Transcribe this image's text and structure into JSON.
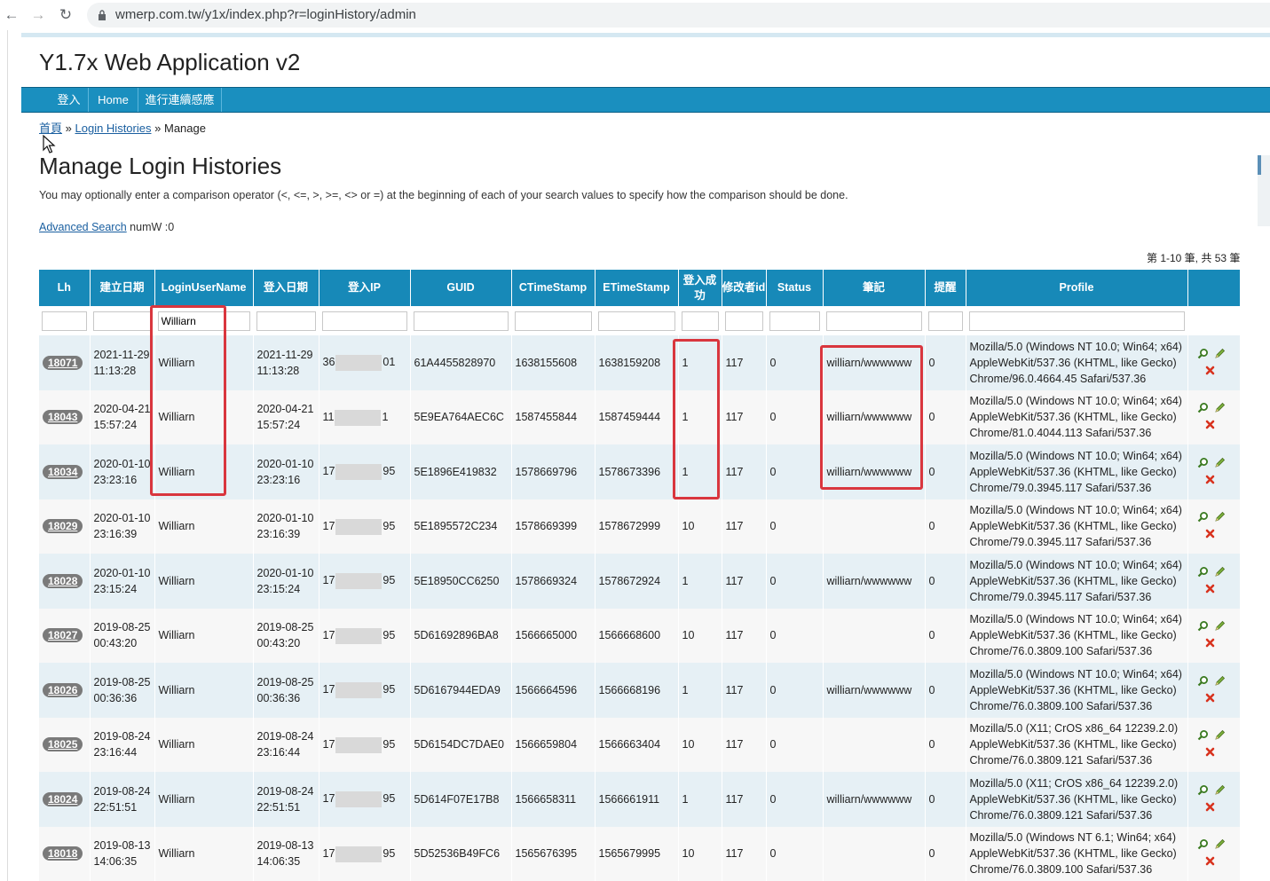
{
  "browser": {
    "url": "wmerp.com.tw/y1x/index.php?r=loginHistory/admin"
  },
  "site": {
    "title": "Y1.7x Web Application v2",
    "menu": [
      "登入",
      "Home",
      "進行連續感應"
    ]
  },
  "breadcrumb": {
    "home": "首頁",
    "sep": "»",
    "list": "Login Histories",
    "current": "Manage"
  },
  "page": {
    "title": "Manage Login Histories",
    "hint": "You may optionally enter a comparison operator (<, <=, >, >=, <> or =) at the beginning of each of your search values to specify how the comparison should be done.",
    "advanced_search": "Advanced Search",
    "numw": "numW :0",
    "summary": "第 1-10 筆, 共 53 筆"
  },
  "table": {
    "headers": [
      "Lh",
      "建立日期",
      "LoginUserName",
      "登入日期",
      "登入IP",
      "GUID",
      "CTimeStamp",
      "ETimeStamp",
      "登入成功",
      "修改者id",
      "Status",
      "筆記",
      "提醒",
      "Profile",
      ""
    ],
    "filter_username": "Williarn",
    "rows": [
      {
        "id": "18071",
        "created": "2021-11-29 11:13:28",
        "user": "Williarn",
        "login": "2021-11-29 11:13:28",
        "ip_a": "36",
        "ip_b": "01",
        "guid": "61A4455828970",
        "ct": "1638155608",
        "et": "1638159208",
        "ok": "1",
        "mod": "117",
        "status": "0",
        "note": "williarn/wwwwww",
        "remind": "0",
        "profile": "Mozilla/5.0 (Windows NT 10.0; Win64; x64) AppleWebKit/537.36 (KHTML, like Gecko) Chrome/96.0.4664.45 Safari/537.36"
      },
      {
        "id": "18043",
        "created": "2020-04-21 15:57:24",
        "user": "Williarn",
        "login": "2020-04-21 15:57:24",
        "ip_a": "11",
        "ip_b": "1",
        "guid": "5E9EA764AEC6C",
        "ct": "1587455844",
        "et": "1587459444",
        "ok": "1",
        "mod": "117",
        "status": "0",
        "note": "williarn/wwwwww",
        "remind": "0",
        "profile": "Mozilla/5.0 (Windows NT 10.0; Win64; x64) AppleWebKit/537.36 (KHTML, like Gecko) Chrome/81.0.4044.113 Safari/537.36"
      },
      {
        "id": "18034",
        "created": "2020-01-10 23:23:16",
        "user": "Williarn",
        "login": "2020-01-10 23:23:16",
        "ip_a": "17",
        "ip_b": "95",
        "guid": "5E1896E419832",
        "ct": "1578669796",
        "et": "1578673396",
        "ok": "1",
        "mod": "117",
        "status": "0",
        "note": "williarn/wwwwww",
        "remind": "0",
        "profile": "Mozilla/5.0 (Windows NT 10.0; Win64; x64) AppleWebKit/537.36 (KHTML, like Gecko) Chrome/79.0.3945.117 Safari/537.36"
      },
      {
        "id": "18029",
        "created": "2020-01-10 23:16:39",
        "user": "Williarn",
        "login": "2020-01-10 23:16:39",
        "ip_a": "17",
        "ip_b": "95",
        "guid": "5E1895572C234",
        "ct": "1578669399",
        "et": "1578672999",
        "ok": "10",
        "mod": "117",
        "status": "0",
        "note": "",
        "remind": "0",
        "profile": "Mozilla/5.0 (Windows NT 10.0; Win64; x64) AppleWebKit/537.36 (KHTML, like Gecko) Chrome/79.0.3945.117 Safari/537.36"
      },
      {
        "id": "18028",
        "created": "2020-01-10 23:15:24",
        "user": "Williarn",
        "login": "2020-01-10 23:15:24",
        "ip_a": "17",
        "ip_b": "95",
        "guid": "5E18950CC6250",
        "ct": "1578669324",
        "et": "1578672924",
        "ok": "1",
        "mod": "117",
        "status": "0",
        "note": "williarn/wwwwww",
        "remind": "0",
        "profile": "Mozilla/5.0 (Windows NT 10.0; Win64; x64) AppleWebKit/537.36 (KHTML, like Gecko) Chrome/79.0.3945.117 Safari/537.36"
      },
      {
        "id": "18027",
        "created": "2019-08-25 00:43:20",
        "user": "Williarn",
        "login": "2019-08-25 00:43:20",
        "ip_a": "17",
        "ip_b": "95",
        "guid": "5D61692896BA8",
        "ct": "1566665000",
        "et": "1566668600",
        "ok": "10",
        "mod": "117",
        "status": "0",
        "note": "",
        "remind": "0",
        "profile": "Mozilla/5.0 (Windows NT 10.0; Win64; x64) AppleWebKit/537.36 (KHTML, like Gecko) Chrome/76.0.3809.100 Safari/537.36"
      },
      {
        "id": "18026",
        "created": "2019-08-25 00:36:36",
        "user": "Williarn",
        "login": "2019-08-25 00:36:36",
        "ip_a": "17",
        "ip_b": "95",
        "guid": "5D6167944EDA9",
        "ct": "1566664596",
        "et": "1566668196",
        "ok": "1",
        "mod": "117",
        "status": "0",
        "note": "williarn/wwwwww",
        "remind": "0",
        "profile": "Mozilla/5.0 (Windows NT 10.0; Win64; x64) AppleWebKit/537.36 (KHTML, like Gecko) Chrome/76.0.3809.100 Safari/537.36"
      },
      {
        "id": "18025",
        "created": "2019-08-24 23:16:44",
        "user": "Williarn",
        "login": "2019-08-24 23:16:44",
        "ip_a": "17",
        "ip_b": "95",
        "guid": "5D6154DC7DAE0",
        "ct": "1566659804",
        "et": "1566663404",
        "ok": "10",
        "mod": "117",
        "status": "0",
        "note": "",
        "remind": "0",
        "profile": "Mozilla/5.0 (X11; CrOS x86_64 12239.2.0) AppleWebKit/537.36 (KHTML, like Gecko) Chrome/76.0.3809.121 Safari/537.36"
      },
      {
        "id": "18024",
        "created": "2019-08-24 22:51:51",
        "user": "Williarn",
        "login": "2019-08-24 22:51:51",
        "ip_a": "17",
        "ip_b": "95",
        "guid": "5D614F07E17B8",
        "ct": "1566658311",
        "et": "1566661911",
        "ok": "1",
        "mod": "117",
        "status": "0",
        "note": "williarn/wwwwww",
        "remind": "0",
        "profile": "Mozilla/5.0 (X11; CrOS x86_64 12239.2.0) AppleWebKit/537.36 (KHTML, like Gecko) Chrome/76.0.3809.121 Safari/537.36"
      },
      {
        "id": "18018",
        "created": "2019-08-13 14:06:35",
        "user": "Williarn",
        "login": "2019-08-13 14:06:35",
        "ip_a": "17",
        "ip_b": "95",
        "guid": "5D52536B49FC6",
        "ct": "1565676395",
        "et": "1565679995",
        "ok": "10",
        "mod": "117",
        "status": "0",
        "note": "",
        "remind": "0",
        "profile": "Mozilla/5.0 (Windows NT 6.1; Win64; x64) AppleWebKit/537.36 (KHTML, like Gecko) Chrome/76.0.3809.100 Safari/537.36"
      }
    ]
  },
  "icons": {
    "view": "magnifier-icon",
    "update": "pencil-icon",
    "delete": "red-x-icon",
    "highlight": "#d9363e",
    "header_bg": "#1789b8"
  }
}
